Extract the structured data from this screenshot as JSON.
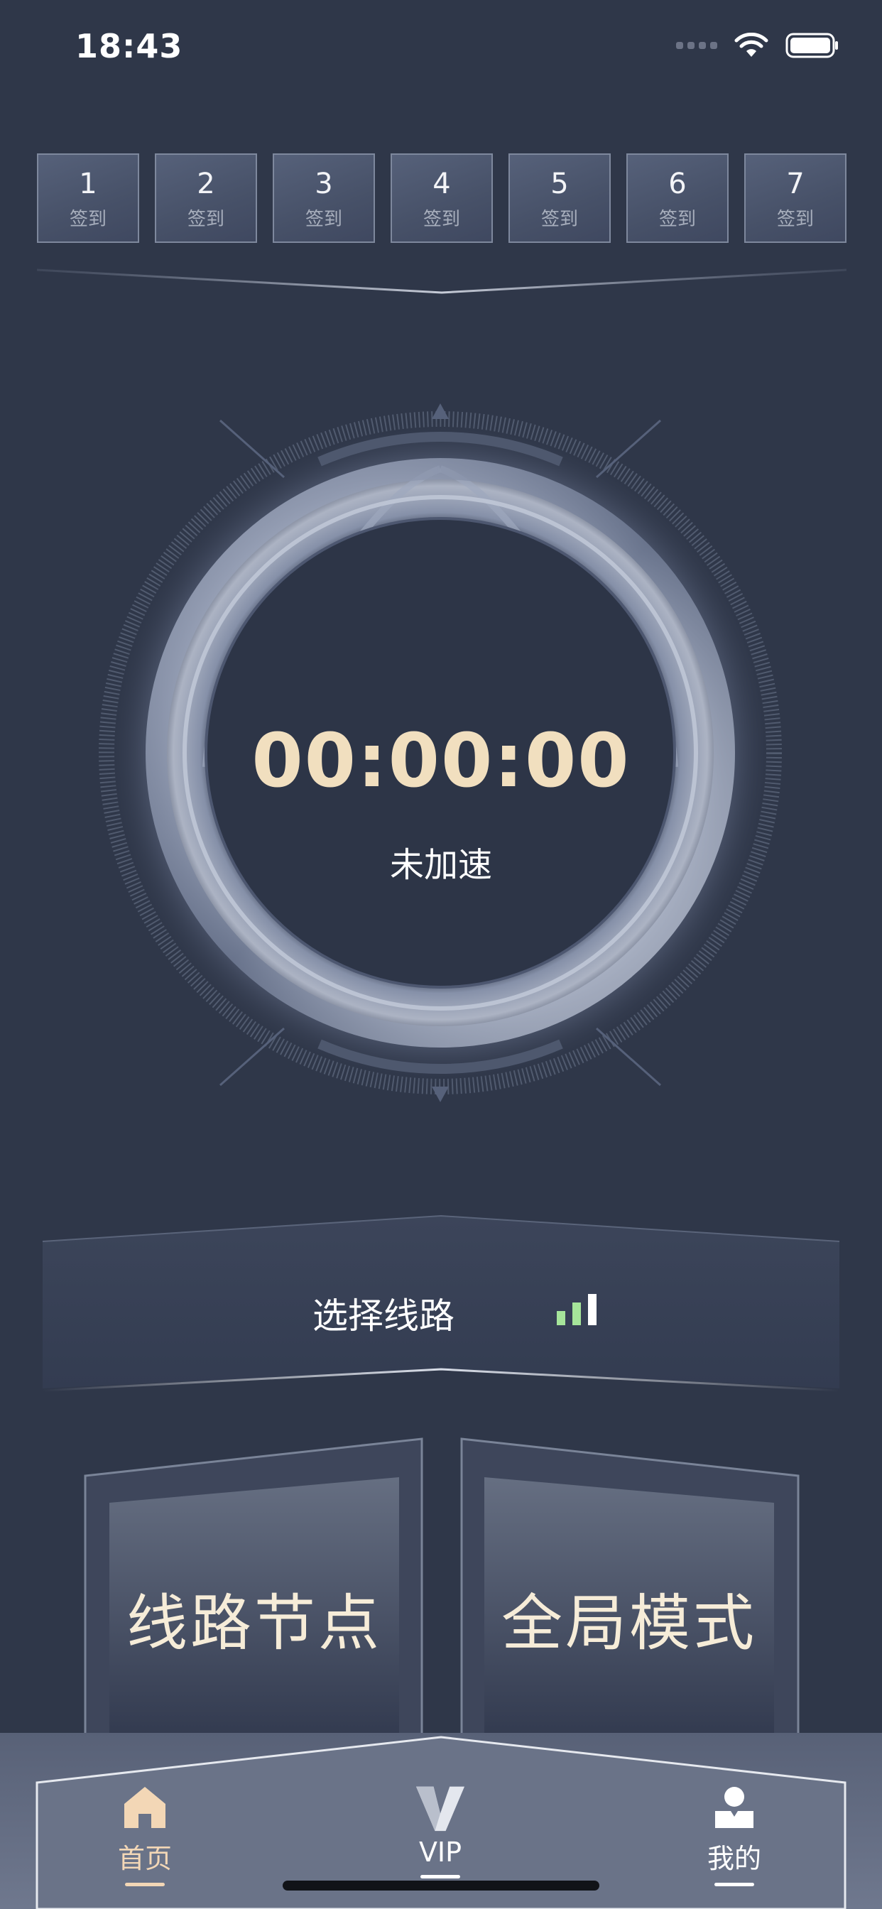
{
  "status_bar": {
    "time": "18:43"
  },
  "signin": {
    "days": [
      {
        "num": "1",
        "label": "签到"
      },
      {
        "num": "2",
        "label": "签到"
      },
      {
        "num": "3",
        "label": "签到"
      },
      {
        "num": "4",
        "label": "签到"
      },
      {
        "num": "5",
        "label": "签到"
      },
      {
        "num": "6",
        "label": "签到"
      },
      {
        "num": "7",
        "label": "签到"
      }
    ]
  },
  "dial": {
    "timer": "00:00:00",
    "status": "未加速"
  },
  "route": {
    "label": "选择线路"
  },
  "modes": {
    "left": "线路节点",
    "right": "全局模式"
  },
  "tabs": {
    "home": "首页",
    "vip": "VIP",
    "mine": "我的"
  },
  "colors": {
    "background": "#2f3749",
    "accent_gold": "#f1dfbf",
    "home_icon": "#f3d7b6",
    "signal_green": "#a6e59a"
  }
}
